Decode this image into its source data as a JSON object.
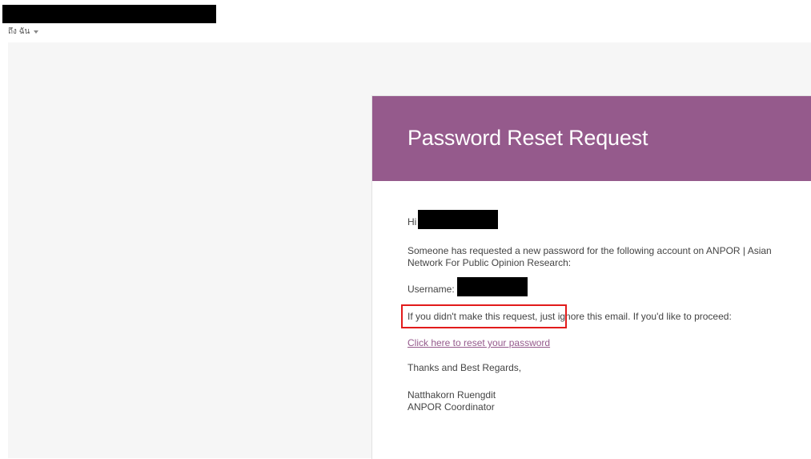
{
  "header": {
    "recipient_label": "ถึง ฉัน"
  },
  "card": {
    "title": "Password Reset Request"
  },
  "message": {
    "greeting": "Hi",
    "paragraph1": "Someone has requested a new password for the following account on ANPOR | Asian Network For Public Opinion Research:",
    "username_label": "Username:",
    "paragraph2": "If you didn't make this request, just ignore this email. If you'd like to proceed:",
    "reset_link": "Click here to reset your password",
    "closing": "Thanks and Best Regards,",
    "signature_name": "Natthakorn Ruengdit",
    "signature_title": "ANPOR Coordinator"
  },
  "colors": {
    "header_purple": "#955a8c",
    "link_purple": "#955a8c",
    "highlight_red": "#e21b1b"
  }
}
